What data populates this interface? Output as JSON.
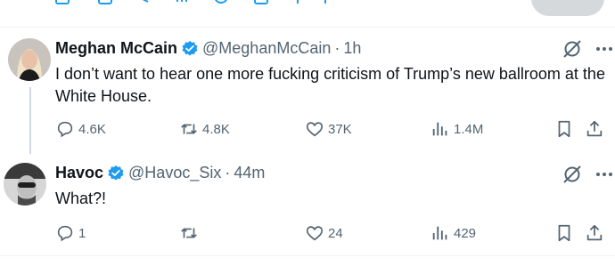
{
  "tweets": [
    {
      "name": "Meghan McCain",
      "handle": "@MeghanMcCain",
      "separator": "·",
      "time": "1h",
      "text": "I don’t want to hear one more fucking criticism of Trump’s new ballroom at the White House.",
      "avatar": "avatar-photo",
      "stats": {
        "replies": "4.6K",
        "reposts": "4.8K",
        "likes": "37K",
        "views": "1.4M"
      }
    },
    {
      "name": "Havoc",
      "handle": "@Havoc_Six",
      "separator": "·",
      "time": "44m",
      "text": "What?!",
      "avatar": "avatar-photo",
      "stats": {
        "replies": "1",
        "reposts": "",
        "likes": "24",
        "views": "429"
      }
    }
  ],
  "colors": {
    "accent": "#1d9bf0",
    "text_primary": "#0f1419",
    "text_secondary": "#536471",
    "divider": "#eff3f4",
    "thread_line": "#cfd9de"
  },
  "icons": [
    "reply-icon",
    "repost-icon",
    "like-icon",
    "views-icon",
    "bookmark-icon",
    "share-icon",
    "grok-icon",
    "more-icon",
    "verified-badge-icon"
  ]
}
